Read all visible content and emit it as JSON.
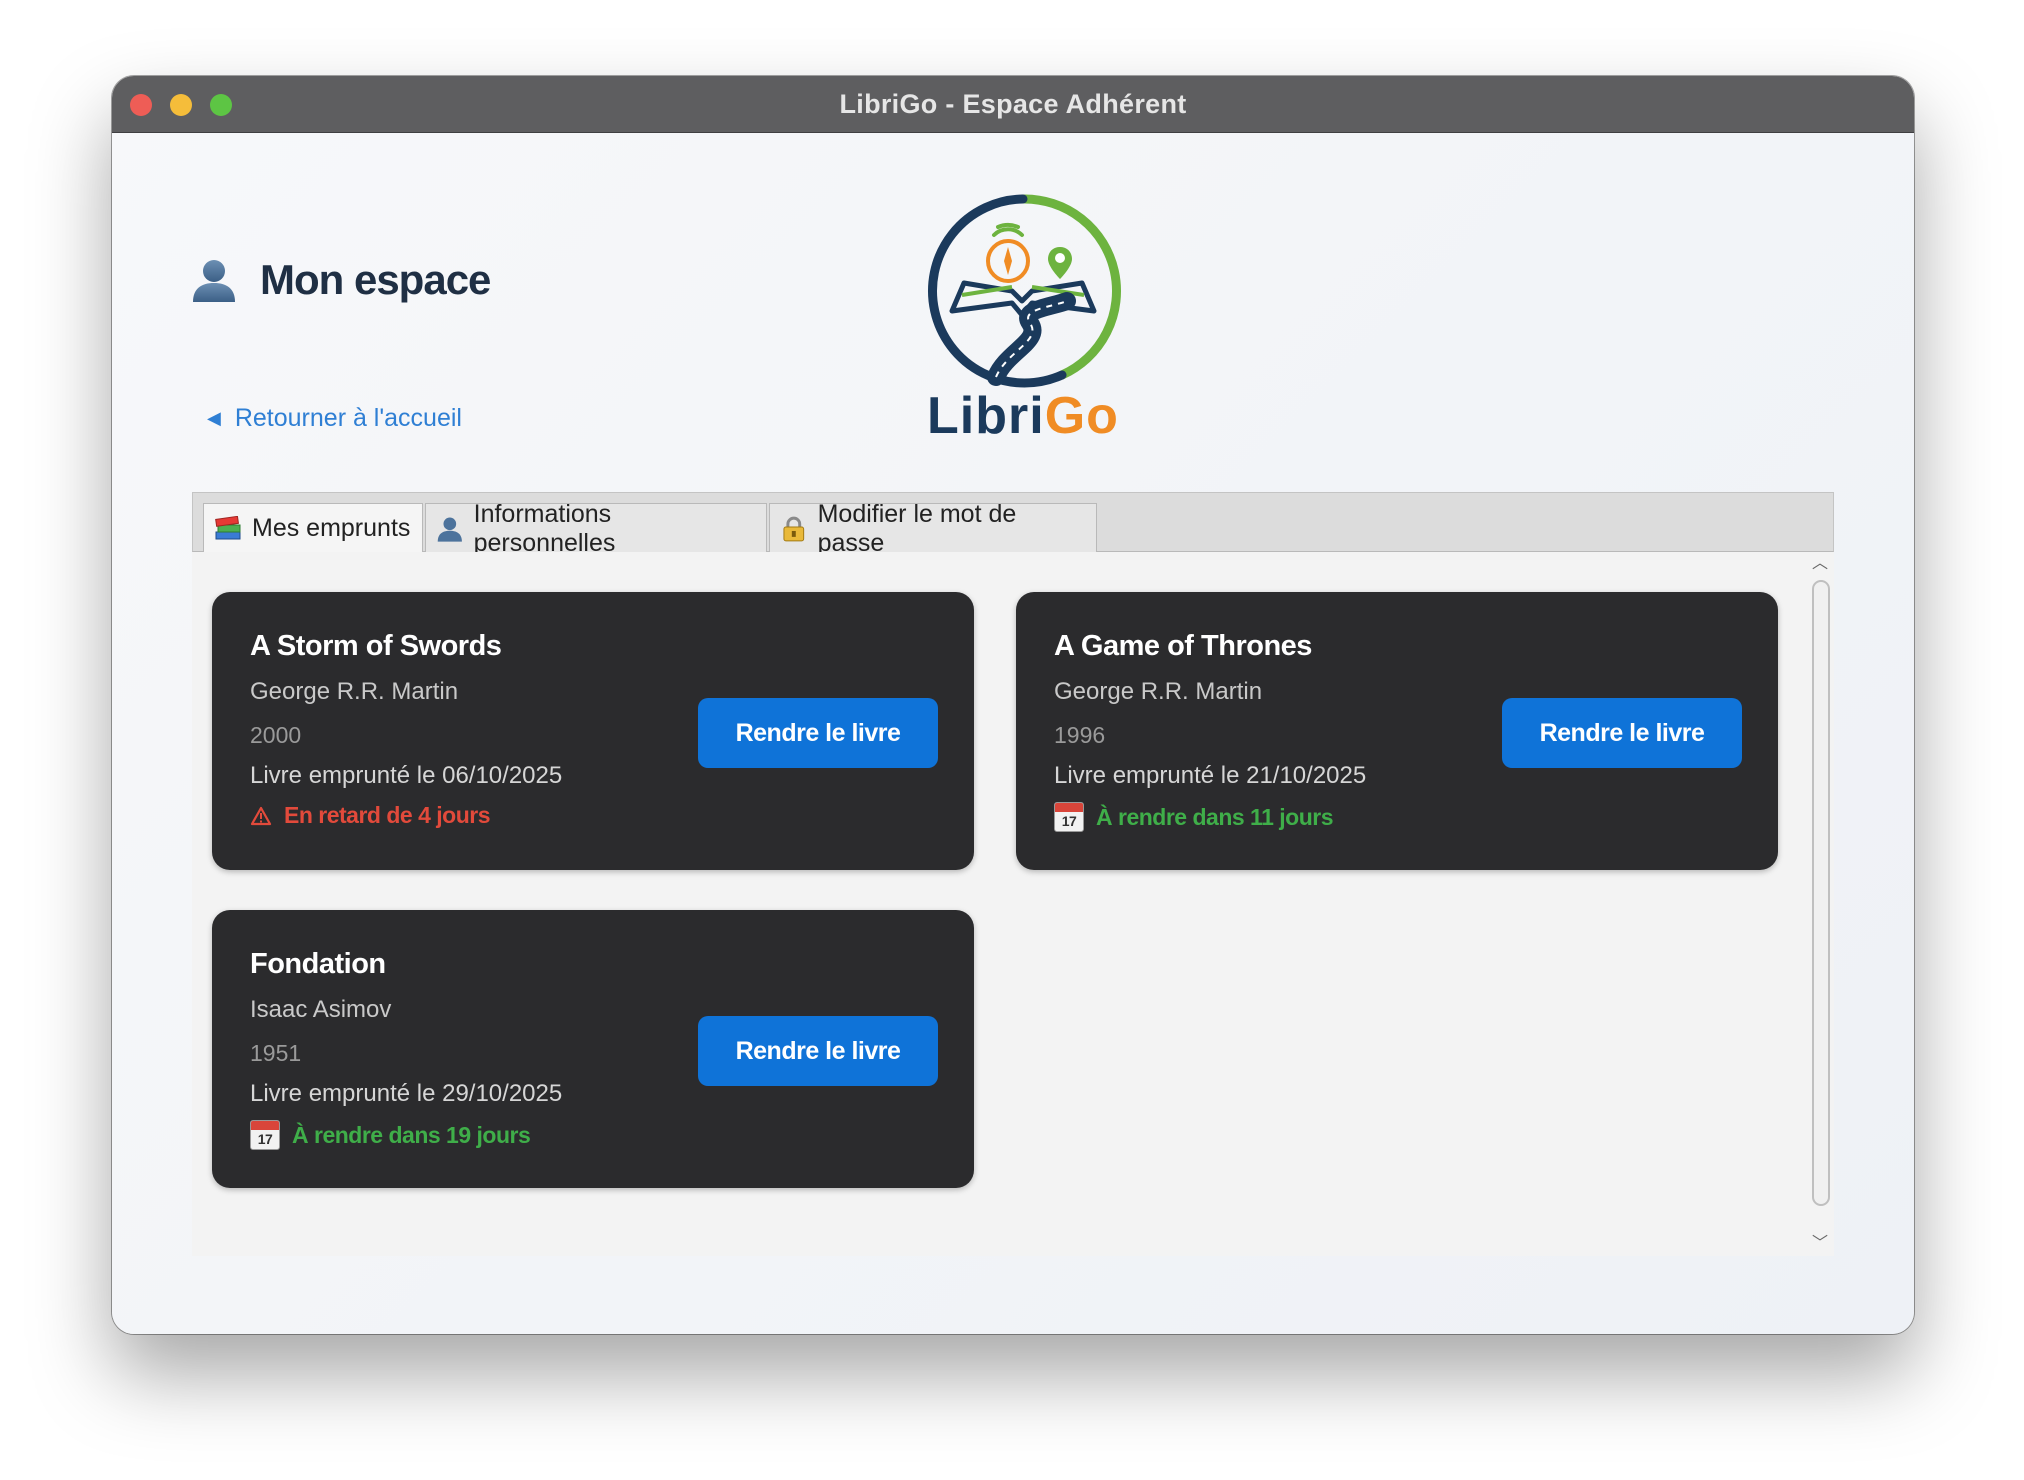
{
  "window": {
    "title": "LibriGo - Espace Adhérent"
  },
  "header": {
    "title": "Mon espace",
    "back_link": "Retourner à l'accueil"
  },
  "logo": {
    "text_part1": "Libri",
    "text_part2": "Go"
  },
  "tabs": [
    {
      "label": "Mes emprunts",
      "icon": "books-icon",
      "active": true
    },
    {
      "label": "Informations personnelles",
      "icon": "user-icon",
      "active": false
    },
    {
      "label": "Modifier le mot de passe",
      "icon": "lock-icon",
      "active": false
    }
  ],
  "loans": [
    {
      "title": "A Storm of Swords",
      "author": "George R.R. Martin",
      "year": "2000",
      "borrowed": "Livre emprunté le 06/10/2025",
      "status": "En retard de 4 jours",
      "status_type": "late",
      "button": "Rendre le livre"
    },
    {
      "title": "A Game of Thrones",
      "author": "George R.R. Martin",
      "year": "1996",
      "borrowed": "Livre emprunté le 21/10/2025",
      "status": "À rendre dans 11 jours",
      "status_type": "ok",
      "button": "Rendre le livre"
    },
    {
      "title": "Fondation",
      "author": "Isaac Asimov",
      "year": "1951",
      "borrowed": "Livre emprunté le 29/10/2025",
      "status": "À rendre dans 19 jours",
      "status_type": "ok",
      "button": "Rendre le livre"
    }
  ],
  "icons": {
    "calendar_day": "17"
  },
  "colors": {
    "accent": "#0f73d8",
    "late": "#e24a3b",
    "ok": "#3fae49",
    "card": "#2b2b2d",
    "logo_navy": "#1b3a5c",
    "logo_orange": "#f08c24",
    "logo_green": "#6db33f"
  }
}
